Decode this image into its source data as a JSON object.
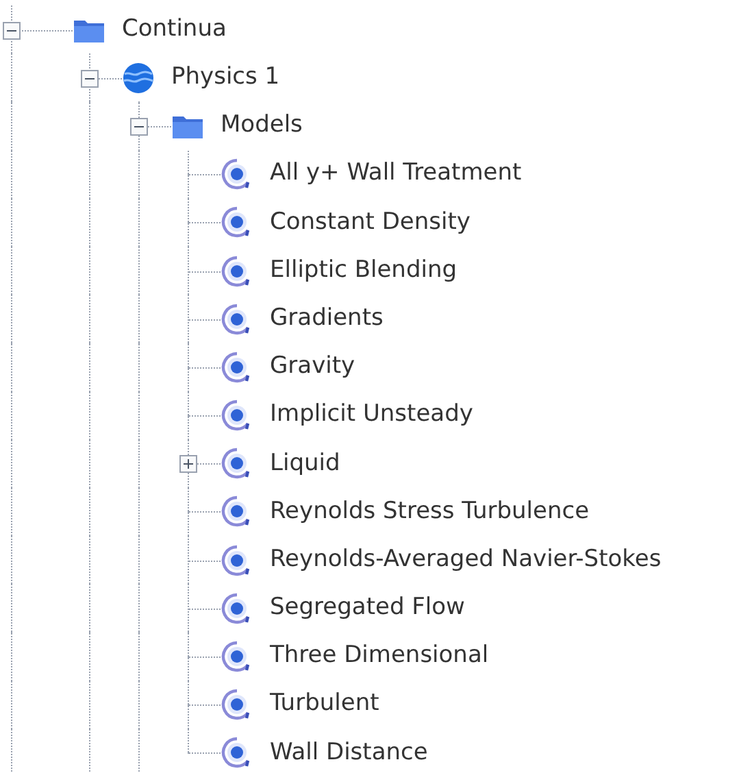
{
  "tree": [
    {
      "label": "Continua",
      "kind": "folder",
      "expanded": true,
      "continues": true,
      "children": [
        {
          "label": "Physics 1",
          "kind": "physics",
          "expanded": true,
          "continues": true,
          "children": [
            {
              "label": "Models",
              "kind": "folder",
              "expanded": true,
              "continues": true,
              "children": [
                {
                  "label": "All y+ Wall Treatment",
                  "kind": "model"
                },
                {
                  "label": "Constant Density",
                  "kind": "model"
                },
                {
                  "label": "Elliptic Blending",
                  "kind": "model"
                },
                {
                  "label": "Gradients",
                  "kind": "model"
                },
                {
                  "label": "Gravity",
                  "kind": "model"
                },
                {
                  "label": "Implicit Unsteady",
                  "kind": "model"
                },
                {
                  "label": "Liquid",
                  "kind": "model",
                  "expanded": false
                },
                {
                  "label": "Reynolds Stress Turbulence",
                  "kind": "model"
                },
                {
                  "label": "Reynolds-Averaged Navier-Stokes",
                  "kind": "model"
                },
                {
                  "label": "Segregated Flow",
                  "kind": "model"
                },
                {
                  "label": "Three Dimensional",
                  "kind": "model"
                },
                {
                  "label": "Turbulent",
                  "kind": "model"
                },
                {
                  "label": "Wall Distance",
                  "kind": "model"
                }
              ]
            }
          ]
        }
      ]
    }
  ]
}
